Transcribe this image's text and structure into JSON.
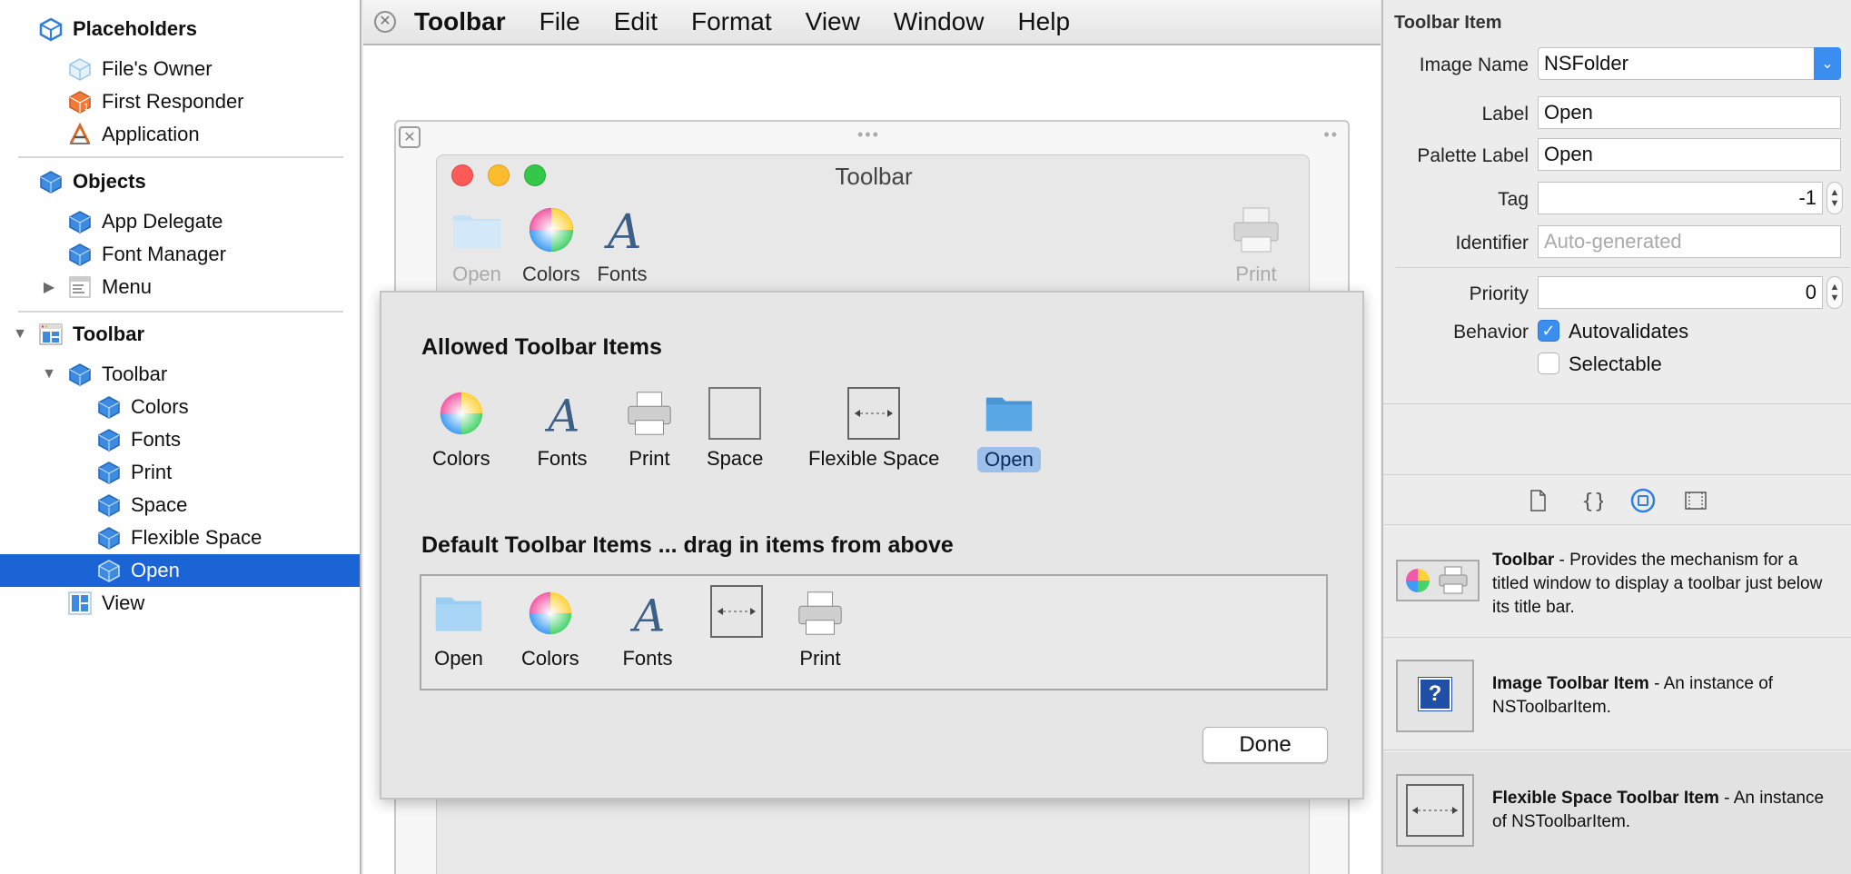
{
  "outline": {
    "placeholders": {
      "label": "Placeholders",
      "items": [
        "File's Owner",
        "First Responder",
        "Application"
      ]
    },
    "objects": {
      "label": "Objects",
      "items": [
        "App Delegate",
        "Font Manager",
        "Menu"
      ]
    },
    "toolbar_root": {
      "label": "Toolbar",
      "child": {
        "label": "Toolbar",
        "items": [
          "Colors",
          "Fonts",
          "Print",
          "Space",
          "Flexible Space",
          "Open"
        ]
      },
      "view": "View"
    },
    "selected": "Open"
  },
  "menubar": {
    "items": [
      "Toolbar",
      "File",
      "Edit",
      "Format",
      "View",
      "Window",
      "Help"
    ]
  },
  "window": {
    "title": "Toolbar",
    "tools": {
      "open": "Open",
      "colors": "Colors",
      "fonts": "Fonts",
      "print": "Print"
    }
  },
  "sheet": {
    "allowed_title": "Allowed Toolbar Items",
    "allowed": [
      "Colors",
      "Fonts",
      "Print",
      "Space",
      "Flexible Space",
      "Open"
    ],
    "default_title": "Default Toolbar Items ... drag in items from above",
    "defaults": [
      "Open",
      "Colors",
      "Fonts",
      "Print"
    ],
    "done": "Done"
  },
  "inspector": {
    "section": "Toolbar Item",
    "image_name": {
      "label": "Image Name",
      "value": "NSFolder"
    },
    "label": {
      "label": "Label",
      "value": "Open"
    },
    "palette_label": {
      "label": "Palette Label",
      "value": "Open"
    },
    "tag": {
      "label": "Tag",
      "value": "-1"
    },
    "identifier": {
      "label": "Identifier",
      "placeholder": "Auto-generated"
    },
    "priority": {
      "label": "Priority",
      "value": "0"
    },
    "behavior": {
      "label": "Behavior",
      "autovalidates": "Autovalidates",
      "selectable": "Selectable"
    }
  },
  "library": [
    {
      "title": "Toolbar",
      "desc": " - Provides the mechanism for a titled window to display a toolbar just below its title bar."
    },
    {
      "title": "Image Toolbar Item",
      "desc": " - An instance of NSToolbarItem."
    },
    {
      "title": "Flexible Space Toolbar Item",
      "desc": " - An instance of NSToolbarItem."
    }
  ],
  "colors": {
    "selection": "#1a64d6",
    "accent": "#3a8ef0",
    "folder": "#5aa7e6"
  }
}
